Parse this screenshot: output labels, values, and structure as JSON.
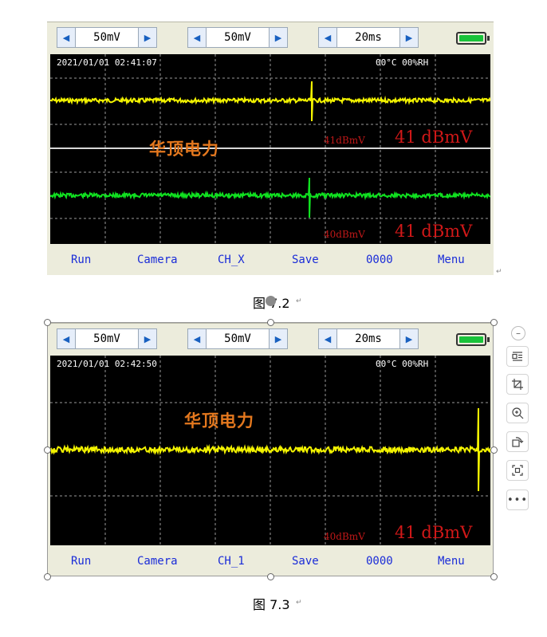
{
  "figures": [
    {
      "toolbar": {
        "ch1_value": "50mV",
        "ch2_value": "50mV",
        "time_value": "20ms"
      },
      "screen": {
        "datetime": "2021/01/01   02:41:07",
        "env": "00°C  00%RH",
        "watermark": "华顶电力",
        "channel1": {
          "level_small": "41dBmV",
          "level_big": "41 dBmV",
          "trace_color": "#f2f200"
        },
        "channel2": {
          "level_small": "40dBmV",
          "level_big": "41 dBmV",
          "trace_color": "#10e020"
        }
      },
      "bottom": {
        "run": "Run",
        "camera": "Camera",
        "channel": "CH_X",
        "save": "Save",
        "count": "0000",
        "menu": "Menu"
      },
      "caption": "图 7.2"
    },
    {
      "toolbar": {
        "ch1_value": "50mV",
        "ch2_value": "50mV",
        "time_value": "20ms"
      },
      "screen": {
        "datetime": "2021/01/01   02:42:50",
        "env": "00°C  00%RH",
        "watermark": "华顶电力",
        "channel1": {
          "level_small": "40dBmV",
          "level_big": "41 dBmV",
          "trace_color": "#f2f200"
        }
      },
      "bottom": {
        "run": "Run",
        "camera": "Camera",
        "channel": "CH_1",
        "save": "Save",
        "count": "0000",
        "menu": "Menu"
      },
      "caption": "图 7.3"
    }
  ],
  "colors": {
    "screen_bg": "#000000",
    "panel_bg": "#ececdc",
    "button_text": "#1a2cd8",
    "level_text": "#d01818",
    "watermark": "#e4781e",
    "battery": "#19c23a"
  },
  "side_toolbar": [
    "collapse-icon",
    "wrap-text-icon",
    "crop-icon",
    "zoom-icon",
    "rotate-icon",
    "fit-frame-icon",
    "more-icon"
  ]
}
